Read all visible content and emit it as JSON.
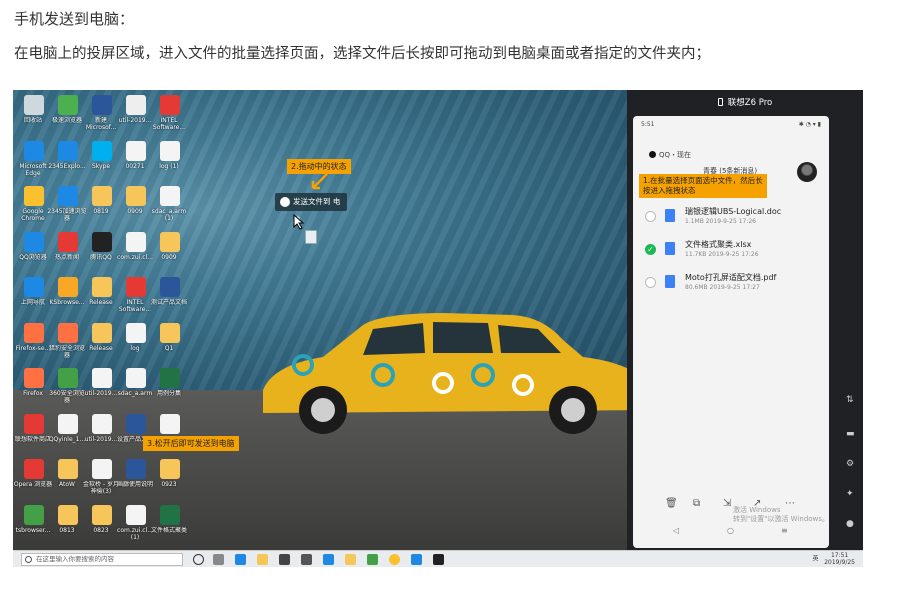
{
  "article": {
    "heading": "手机发送到电脑：",
    "paragraph": "在电脑上的投屏区域，进入文件的批量选择页面，选择文件后长按即可拖动到电脑桌面或者指定的文件夹内；"
  },
  "desktop": {
    "icons": [
      {
        "label": "回收站",
        "color": "#cfd8dc"
      },
      {
        "label": "极速浏览器",
        "color": "#4caf50"
      },
      {
        "label": "新建 Microsof...",
        "color": "#2b579a"
      },
      {
        "label": "util-2019...",
        "color": "#eeeeee"
      },
      {
        "label": "INTEL Software...",
        "color": "#e53935"
      },
      {
        "label": "Microsoft Edge",
        "color": "#1e88e5"
      },
      {
        "label": "2345Explo...",
        "color": "#1e88e5"
      },
      {
        "label": "Skype",
        "color": "#00aff0"
      },
      {
        "label": "00271",
        "color": "#f4f4f4"
      },
      {
        "label": "log (1)",
        "color": "#f4f4f4"
      },
      {
        "label": "Google Chrome",
        "color": "#fbc02d"
      },
      {
        "label": "2345加速浏览器",
        "color": "#1e88e5"
      },
      {
        "label": "0819",
        "color": "#f6c65b"
      },
      {
        "label": "0909",
        "color": "#f6c65b"
      },
      {
        "label": "sdac_a.arm (1)",
        "color": "#f4f4f4"
      },
      {
        "label": "QQ浏览器",
        "color": "#1e88e5"
      },
      {
        "label": "热点新闻",
        "color": "#e53935"
      },
      {
        "label": "腾讯QQ",
        "color": "#222222"
      },
      {
        "label": "com.zui.cl...",
        "color": "#f4f4f4"
      },
      {
        "label": "0909",
        "color": "#f6c65b"
      },
      {
        "label": "上网导航",
        "color": "#1e88e5"
      },
      {
        "label": "KSbrowse...",
        "color": "#f9a825"
      },
      {
        "label": "Release",
        "color": "#f6c65b"
      },
      {
        "label": "INTEL Software...",
        "color": "#e53935"
      },
      {
        "label": "测试产品文档",
        "color": "#2b579a"
      },
      {
        "label": "Firefox-se...",
        "color": "#ff7043"
      },
      {
        "label": "猎豹安全浏览器",
        "color": "#ff7043"
      },
      {
        "label": "Release",
        "color": "#f6c65b"
      },
      {
        "label": "log",
        "color": "#f4f4f4"
      },
      {
        "label": "Q1",
        "color": "#f6c65b"
      },
      {
        "label": "Firefox",
        "color": "#ff7043"
      },
      {
        "label": "360安全浏览器",
        "color": "#43a047"
      },
      {
        "label": "util-2019...",
        "color": "#f4f4f4"
      },
      {
        "label": "sdac_a.arm",
        "color": "#f4f4f4"
      },
      {
        "label": "用例分集",
        "color": "#217346"
      },
      {
        "label": "联想软件商店",
        "color": "#e53935"
      },
      {
        "label": "QQyinle_1...",
        "color": "#f4f4f4"
      },
      {
        "label": "util-2019...",
        "color": "#f4f4f4"
      },
      {
        "label": "设置产品文档",
        "color": "#2b579a"
      },
      {
        "label": "hhgg",
        "color": "#f4f4f4"
      },
      {
        "label": "Opera 浏览器",
        "color": "#e53935"
      },
      {
        "label": "AtoW",
        "color": "#f6c65b"
      },
      {
        "label": "金软桥 - 岁月神偷(3)",
        "color": "#f4f4f4"
      },
      {
        "label": "画廊使用说明",
        "color": "#2b579a"
      },
      {
        "label": "0923",
        "color": "#f6c65b"
      },
      {
        "label": "tsbrowser...",
        "color": "#43a047"
      },
      {
        "label": "0813",
        "color": "#f6c65b"
      },
      {
        "label": "0823",
        "color": "#f6c65b"
      },
      {
        "label": "com.zui.cl... (1)",
        "color": "#f4f4f4"
      },
      {
        "label": "文件格式聚类",
        "color": "#217346"
      }
    ],
    "callout_drag_state": "2.拖动中的状态",
    "callout_release": "3.松开后即可发送到电脑",
    "drag_chip_label": "发送文件到 电脑",
    "taskbar": {
      "search_placeholder": "在这里输入你要搜索的内容",
      "tray_time": "17:51",
      "tray_date": "2019/9/25",
      "tray_lang": "英"
    }
  },
  "phone_pane": {
    "title": "联想Z6 Pro",
    "status_time": "5:51",
    "status_right": "✱ ◔ ▾ ▮",
    "qq_source": "QQ・现在",
    "contact_line": "青春 (5条新消息)",
    "callout_select": "1.在批量选择页面选中文件，然后长按进入拖拽状态",
    "files": [
      {
        "name": "瑞银逻辑UBS-Logical.doc",
        "meta": "1.1MB  2019-9-25 17:26",
        "checked": false
      },
      {
        "name": "文件格式聚类.xlsx",
        "meta": "11.7KB  2019-9-25 17:26",
        "checked": true
      },
      {
        "name": "Moto打孔屏适配文档.pdf",
        "meta": "80.6MB  2019-9-25 17:27",
        "checked": false
      }
    ],
    "watermark_line1": "激活 Windows",
    "watermark_line2": "转到\"设置\"以激活 Windows。"
  }
}
